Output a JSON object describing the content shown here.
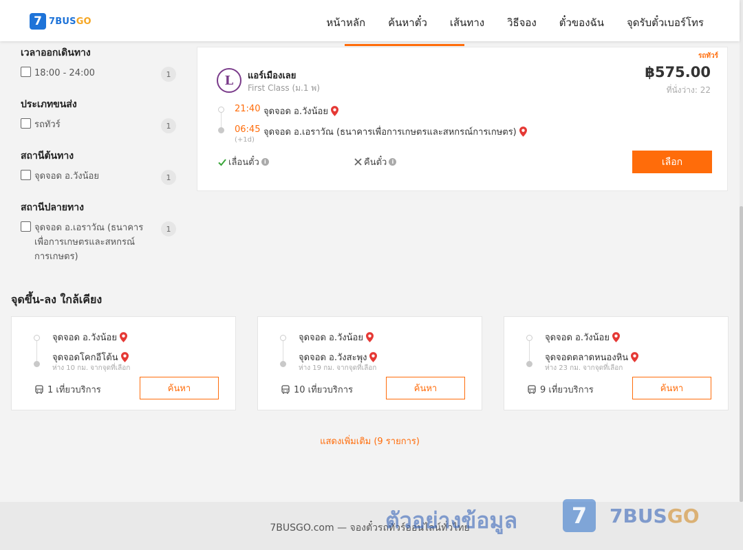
{
  "header": {
    "logo_mark": "7",
    "logo_text_main": "7BUS",
    "logo_text_accent": "GO",
    "nav": [
      "หน้าหลัก",
      "ค้นหาตั๋ว",
      "เส้นทาง",
      "วิธีจอง",
      "ตั๋วของฉัน",
      "จุดรับตั๋วเบอร์โทร"
    ]
  },
  "filters": [
    {
      "title": "เวลาออกเดินทาง",
      "option": "18:00 - 24:00",
      "count": "1"
    },
    {
      "title": "ประเภทขนส่ง",
      "option": "รถทัวร์",
      "count": "1"
    },
    {
      "title": "สถานีต้นทาง",
      "option": "จุดจอด อ.วังน้อย",
      "count": "1"
    },
    {
      "title": "สถานีปลายทาง",
      "option": "จุดจอด อ.เอราวัณ (ธนาคารเพื่อการเกษตรและสหกรณ์การเกษตร)",
      "count": "1"
    }
  ],
  "trip": {
    "tag": "รถทัวร์",
    "operator_logo": "L",
    "operator": "แอร์เมืองเลย",
    "class": "First Class (ม.1 พ)",
    "price": "฿575.00",
    "seats": "ที่นั่งว่าง: 22",
    "depart_time": "21:40",
    "depart_stop": "จุดจอด อ.วังน้อย",
    "arrive_time": "06:45",
    "arrive_stop": "จุดจอด อ.เอราวัณ (ธนาคารเพื่อการเกษตรและสหกรณ์การเกษตร)",
    "plus_day": "(+1d)",
    "reschedule": "เลื่อนตั๋ว",
    "refund": "คืนตั๋ว",
    "select_label": "เลือก"
  },
  "nearby": {
    "title": "จุดขึ้น-ลง ใกล้เคียง",
    "cards": [
      {
        "from": "จุดจอด อ.วังน้อย",
        "to": "จุดจอดโคกอีโต้น",
        "distance": "ห่าง 10 กม. จากจุดที่เลือก",
        "trips": "1 เที่ยวบริการ",
        "button": "ค้นหา"
      },
      {
        "from": "จุดจอด อ.วังน้อย",
        "to": "จุดจอด อ.วังสะพุง",
        "distance": "ห่าง 19 กม. จากจุดที่เลือก",
        "trips": "10 เที่ยวบริการ",
        "button": "ค้นหา"
      },
      {
        "from": "จุดจอด อ.วังน้อย",
        "to": "จุดจอดตลาดหนองหิน",
        "distance": "ห่าง 23 กม. จากจุดที่เลือก",
        "trips": "9 เที่ยวบริการ",
        "button": "ค้นหา"
      }
    ],
    "show_more": "แสดงเพิ่มเติม (9 รายการ)"
  },
  "footer": {
    "text": "7BUSGO.com — จองตั๋วรถทัวร์ออนไลน์ทั่วไทย"
  },
  "watermark": {
    "text": "ตัวอย่างข้อมูล",
    "logo_mark": "7",
    "brand_main": "7BUS",
    "brand_accent": "GO"
  },
  "colors": {
    "accent": "#ff6c0a",
    "brand": "#1e73d8",
    "check": "#3aa53a"
  }
}
